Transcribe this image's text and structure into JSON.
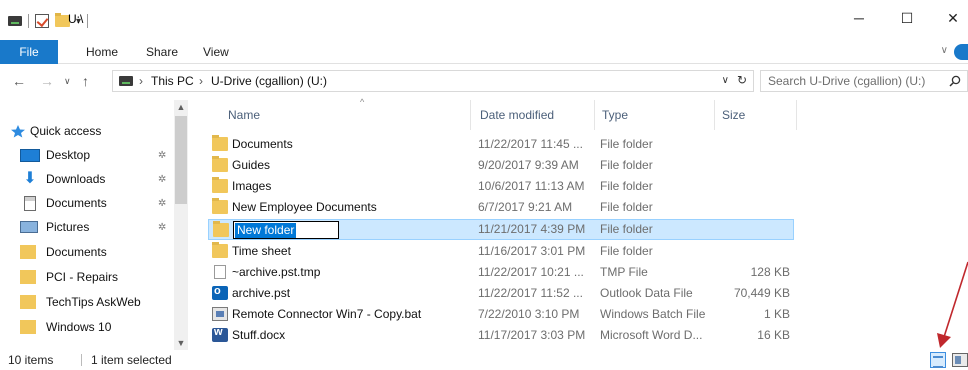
{
  "window": {
    "title": "U:\\",
    "min_glyph": "─",
    "max_glyph": "☐",
    "close_glyph": "✕"
  },
  "quick_access_toolbar": {
    "dropdown_glyph": "▾"
  },
  "ribbon": {
    "tabs": [
      "File",
      "Home",
      "Share",
      "View"
    ],
    "collapse_glyph": "∨"
  },
  "address_bar": {
    "breadcrumbs": [
      "This PC",
      "U-Drive (cgallion) (U:)"
    ],
    "separator": "›",
    "search_placeholder": "Search U-Drive (cgallion) (U:)"
  },
  "navigation_pane": {
    "items": [
      {
        "label": "Quick access",
        "icon": "star-icon",
        "pinned": false
      },
      {
        "label": "Desktop",
        "icon": "desktop-icon",
        "pinned": true
      },
      {
        "label": "Downloads",
        "icon": "download-icon",
        "pinned": true
      },
      {
        "label": "Documents",
        "icon": "documents-icon",
        "pinned": true
      },
      {
        "label": "Pictures",
        "icon": "pictures-icon",
        "pinned": true
      },
      {
        "label": "Documents",
        "icon": "folder-icon",
        "pinned": false
      },
      {
        "label": "PCI - Repairs",
        "icon": "folder-icon",
        "pinned": false
      },
      {
        "label": "TechTips AskWeb",
        "icon": "folder-icon",
        "pinned": false
      },
      {
        "label": "Windows 10",
        "icon": "folder-icon",
        "pinned": false
      }
    ]
  },
  "file_list": {
    "columns": [
      "Name",
      "Date modified",
      "Type",
      "Size"
    ],
    "rows": [
      {
        "name": "Documents",
        "date": "11/22/2017 11:45 ...",
        "type": "File folder",
        "size": "",
        "icon": "folder-icon"
      },
      {
        "name": "Guides",
        "date": "9/20/2017 9:39 AM",
        "type": "File folder",
        "size": "",
        "icon": "folder-icon"
      },
      {
        "name": "Images",
        "date": "10/6/2017 11:13 AM",
        "type": "File folder",
        "size": "",
        "icon": "folder-icon"
      },
      {
        "name": "New Employee Documents",
        "date": "6/7/2017 9:21 AM",
        "type": "File folder",
        "size": "",
        "icon": "folder-icon"
      },
      {
        "name": "New folder",
        "date": "11/21/2017 4:39 PM",
        "type": "File folder",
        "size": "",
        "icon": "folder-icon",
        "selected": true,
        "renaming": true
      },
      {
        "name": "Time sheet",
        "date": "11/16/2017 3:01 PM",
        "type": "File folder",
        "size": "",
        "icon": "folder-icon"
      },
      {
        "name": "~archive.pst.tmp",
        "date": "11/22/2017 10:21 ...",
        "type": "TMP File",
        "size": "128 KB",
        "icon": "blank-file-icon"
      },
      {
        "name": "archive.pst",
        "date": "11/22/2017 11:52 ...",
        "type": "Outlook Data File",
        "size": "70,449 KB",
        "icon": "outlook-file-icon"
      },
      {
        "name": "Remote Connector Win7 - Copy.bat",
        "date": "7/22/2010 3:10 PM",
        "type": "Windows Batch File",
        "size": "1 KB",
        "icon": "batch-file-icon"
      },
      {
        "name": "Stuff.docx",
        "date": "11/17/2017 3:03 PM",
        "type": "Microsoft Word D...",
        "size": "16 KB",
        "icon": "word-file-icon"
      }
    ]
  },
  "status_bar": {
    "item_count": "10 items",
    "selection": "1 item selected"
  },
  "colors": {
    "accent": "#1979ca",
    "selection_bg": "#cce8ff",
    "annotation_arrow": "#c0282d"
  }
}
